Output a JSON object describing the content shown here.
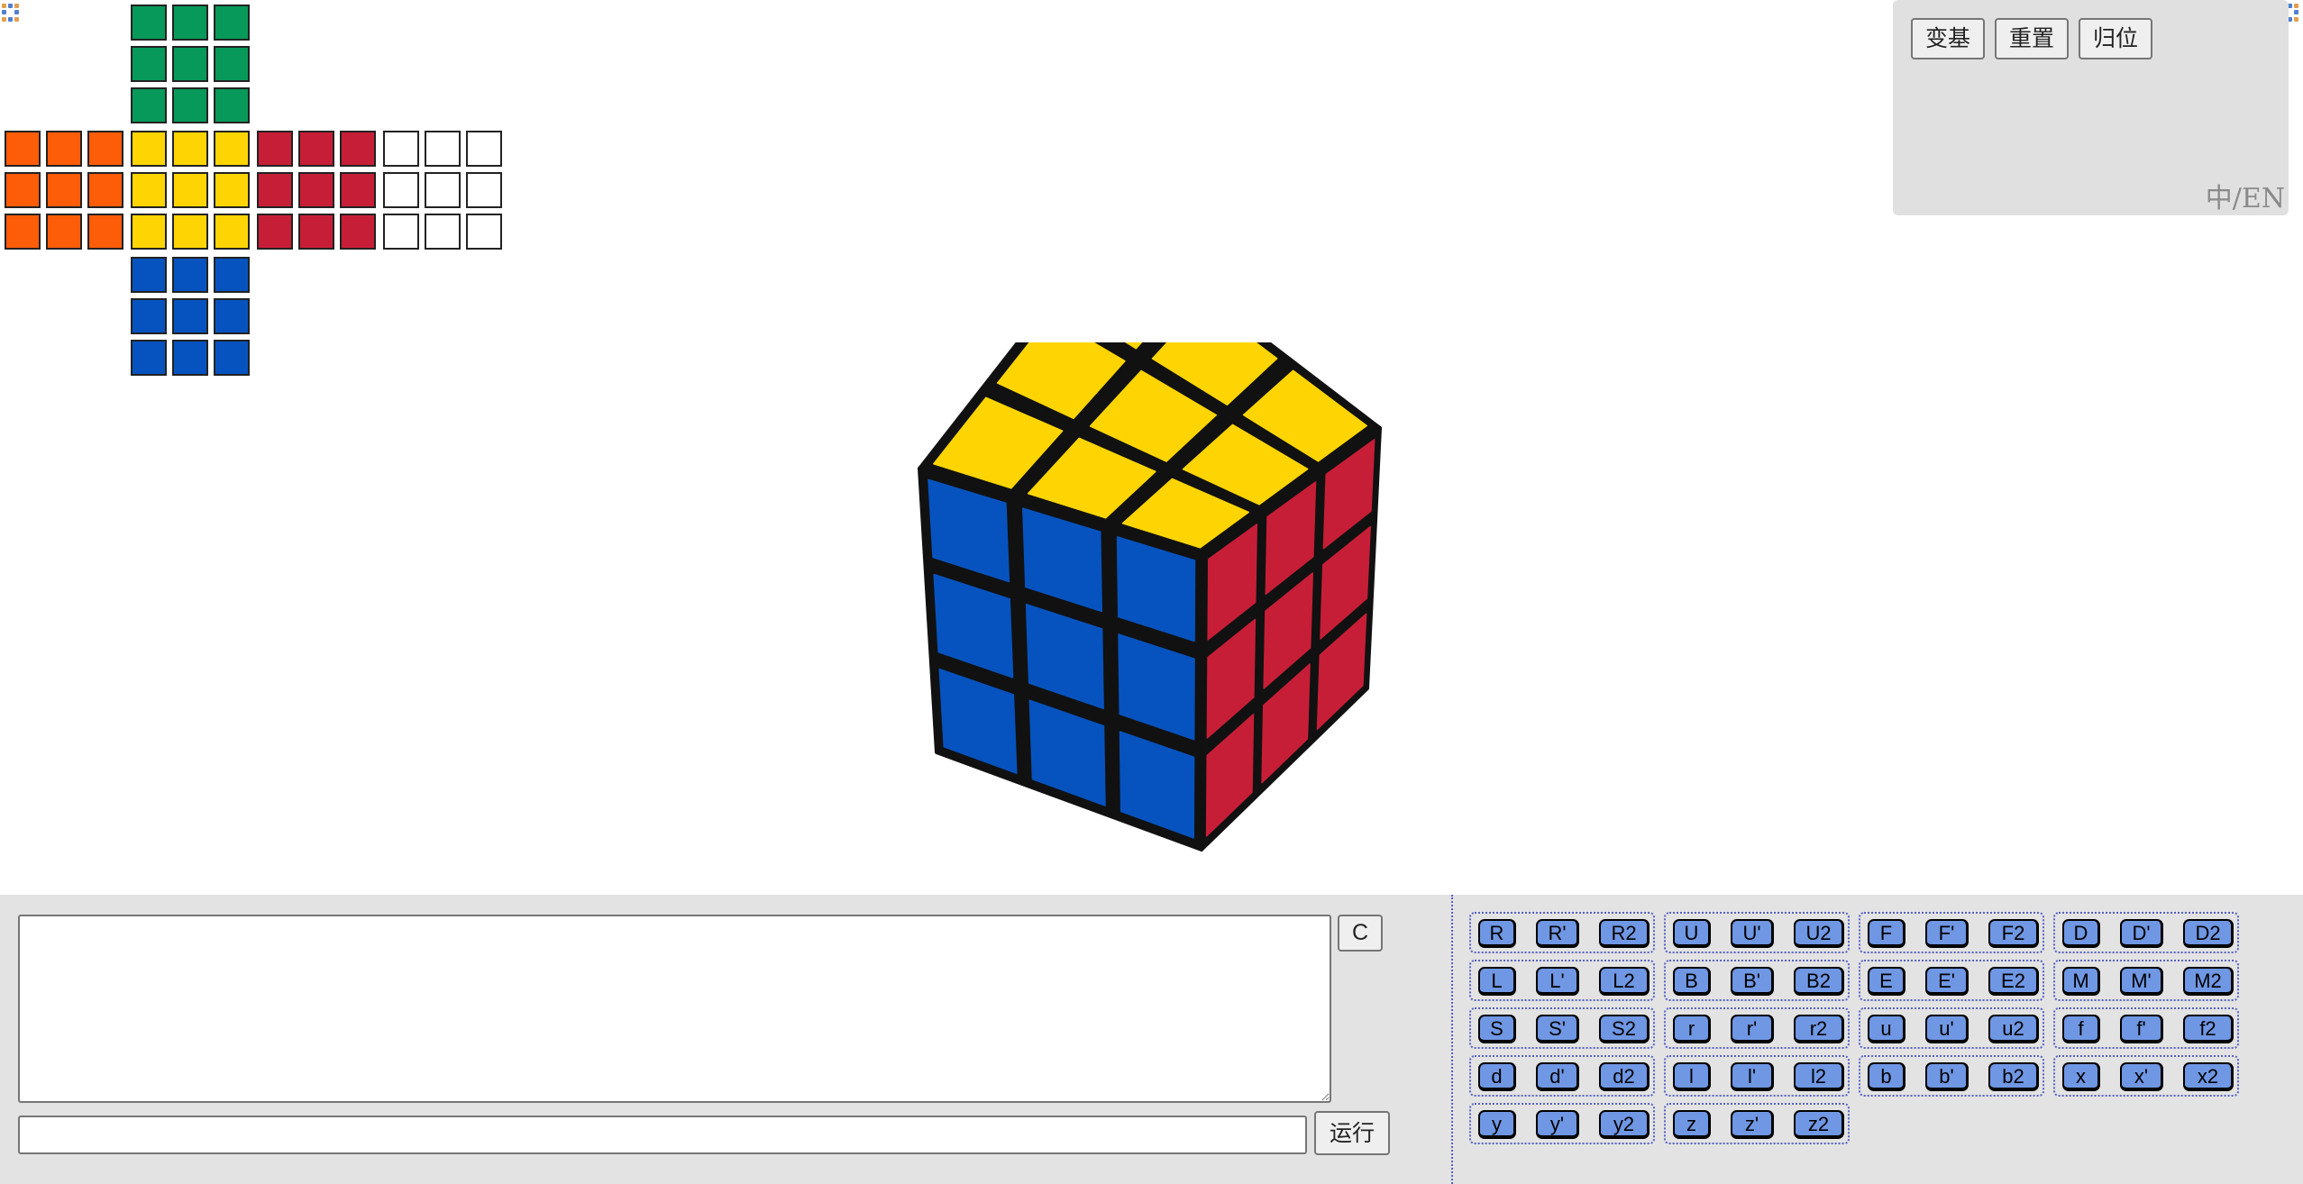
{
  "colors": {
    "green": "#07995a",
    "orange": "#fd5c08",
    "yellow": "#fed502",
    "red": "#c71e37",
    "white": "#ffffff",
    "blue": "#0653bf",
    "move_button": "#6f97e4",
    "panel_bg": "#e0e0e0"
  },
  "net": {
    "up": [
      "green",
      "green",
      "green",
      "green",
      "green",
      "green",
      "green",
      "green",
      "green"
    ],
    "left": [
      "orange",
      "orange",
      "orange",
      "orange",
      "orange",
      "orange",
      "orange",
      "orange",
      "orange"
    ],
    "front": [
      "yellow",
      "yellow",
      "yellow",
      "yellow",
      "yellow",
      "yellow",
      "yellow",
      "yellow",
      "yellow"
    ],
    "right": [
      "red",
      "red",
      "red",
      "red",
      "red",
      "red",
      "red",
      "red",
      "red"
    ],
    "back": [
      "white",
      "white",
      "white",
      "white",
      "white",
      "white",
      "white",
      "white",
      "white"
    ],
    "down": [
      "blue",
      "blue",
      "blue",
      "blue",
      "blue",
      "blue",
      "blue",
      "blue",
      "blue"
    ]
  },
  "cube3d": {
    "top": "yellow",
    "left": "blue",
    "right": "red"
  },
  "panel": {
    "buttons": [
      "变基",
      "重置",
      "归位"
    ],
    "lang_toggle": "中/EN"
  },
  "controls": {
    "textarea_value": "",
    "clear_label": "C",
    "command_value": "",
    "run_label": "运行"
  },
  "move_groups": [
    [
      "R",
      "R'",
      "R2"
    ],
    [
      "U",
      "U'",
      "U2"
    ],
    [
      "F",
      "F'",
      "F2"
    ],
    [
      "D",
      "D'",
      "D2"
    ],
    [
      "L",
      "L'",
      "L2"
    ],
    [
      "B",
      "B'",
      "B2"
    ],
    [
      "E",
      "E'",
      "E2"
    ],
    [
      "M",
      "M'",
      "M2"
    ],
    [
      "S",
      "S'",
      "S2"
    ],
    [
      "r",
      "r'",
      "r2"
    ],
    [
      "u",
      "u'",
      "u2"
    ],
    [
      "f",
      "f'",
      "f2"
    ],
    [
      "d",
      "d'",
      "d2"
    ],
    [
      "l",
      "l'",
      "l2"
    ],
    [
      "b",
      "b'",
      "b2"
    ],
    [
      "x",
      "x'",
      "x2"
    ],
    [
      "y",
      "y'",
      "y2"
    ],
    [
      "z",
      "z'",
      "z2"
    ]
  ]
}
